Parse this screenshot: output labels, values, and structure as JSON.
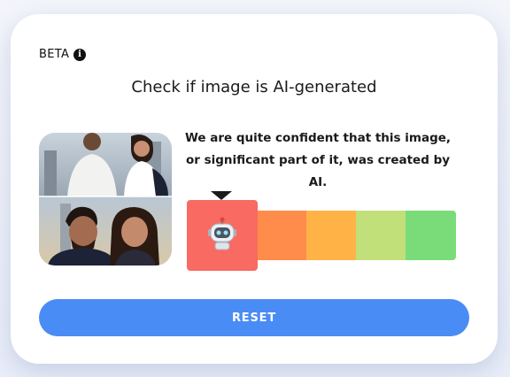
{
  "header": {
    "beta_label": "BETA",
    "info_icon": "info-icon"
  },
  "main": {
    "title": "Check if image is AI-generated",
    "verdict": "We are quite confident that this image, or significant part of it, was created by AI.",
    "scale": {
      "levels": 5,
      "active_level": 1,
      "colors": [
        "#f86a62",
        "#ff8c4a",
        "#ffb347",
        "#c2e07a",
        "#79dc79"
      ],
      "active_icon": "robot-icon"
    }
  },
  "actions": {
    "reset_label": "RESET"
  }
}
